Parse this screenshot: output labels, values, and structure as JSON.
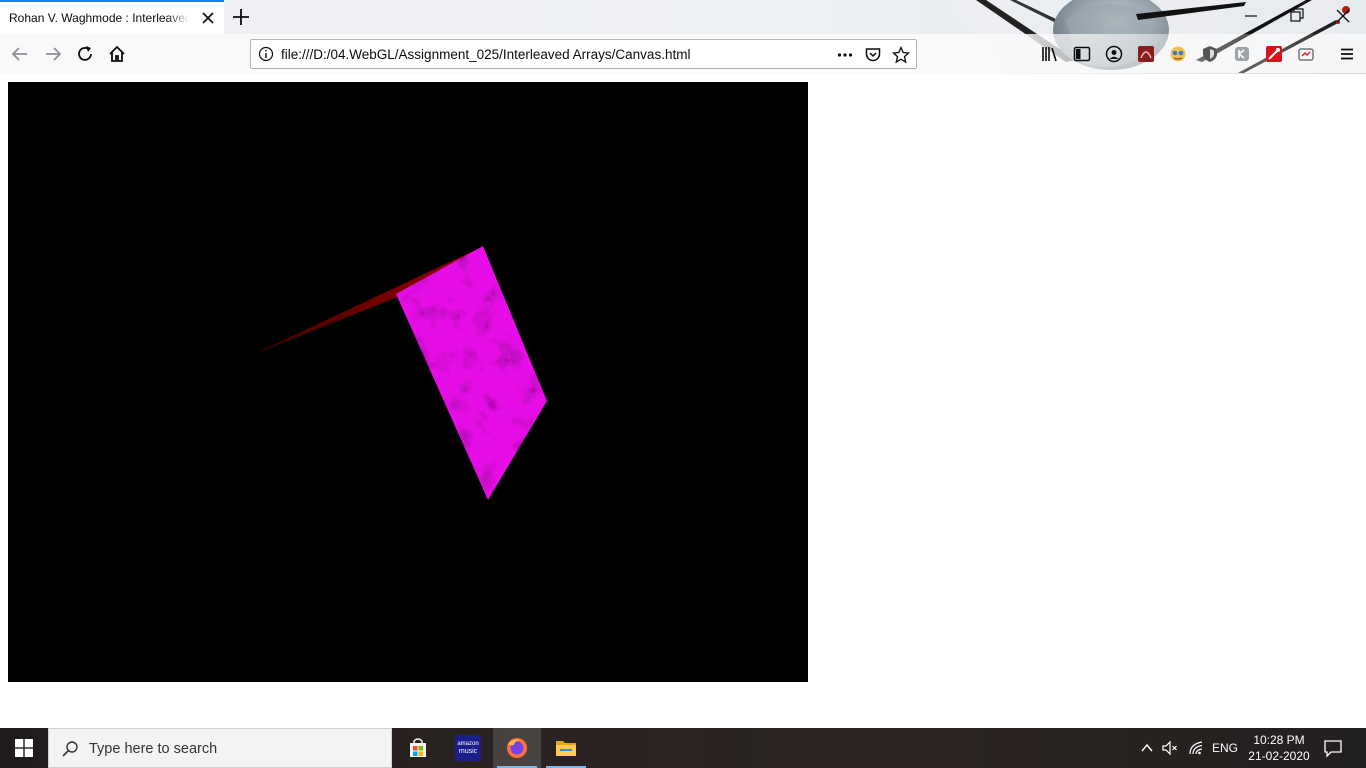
{
  "browser": {
    "tab_title": "Rohan V. Waghmode : Interleaved Arrays",
    "url": "file:///D:/04.WebGL/Assignment_025/Interleaved Arrays/Canvas.html",
    "accent_color": "#0a84ff",
    "toolbar_icons": [
      "library-icon",
      "sidebar-icon",
      "account-icon",
      "pdf-icon",
      "extension-icon",
      "shield-icon",
      "extension-icon",
      "extension-icon",
      "screenshot-icon",
      "menu-icon"
    ]
  },
  "canvas": {
    "background_color": "#000000",
    "shapes": [
      "red-triangle",
      "magenta-marble-quad"
    ],
    "quad_color": "#e60fe6",
    "triangle_color": "#8a0000"
  },
  "taskbar": {
    "search_placeholder": "Type here to search",
    "apps": [
      "store-icon",
      "amazon-music-icon",
      "firefox-icon",
      "file-explorer-icon"
    ],
    "amazon_label_line1": "amazon",
    "amazon_label_line2": "music",
    "language": "ENG",
    "time": "10:28 PM",
    "date": "21-02-2020"
  }
}
